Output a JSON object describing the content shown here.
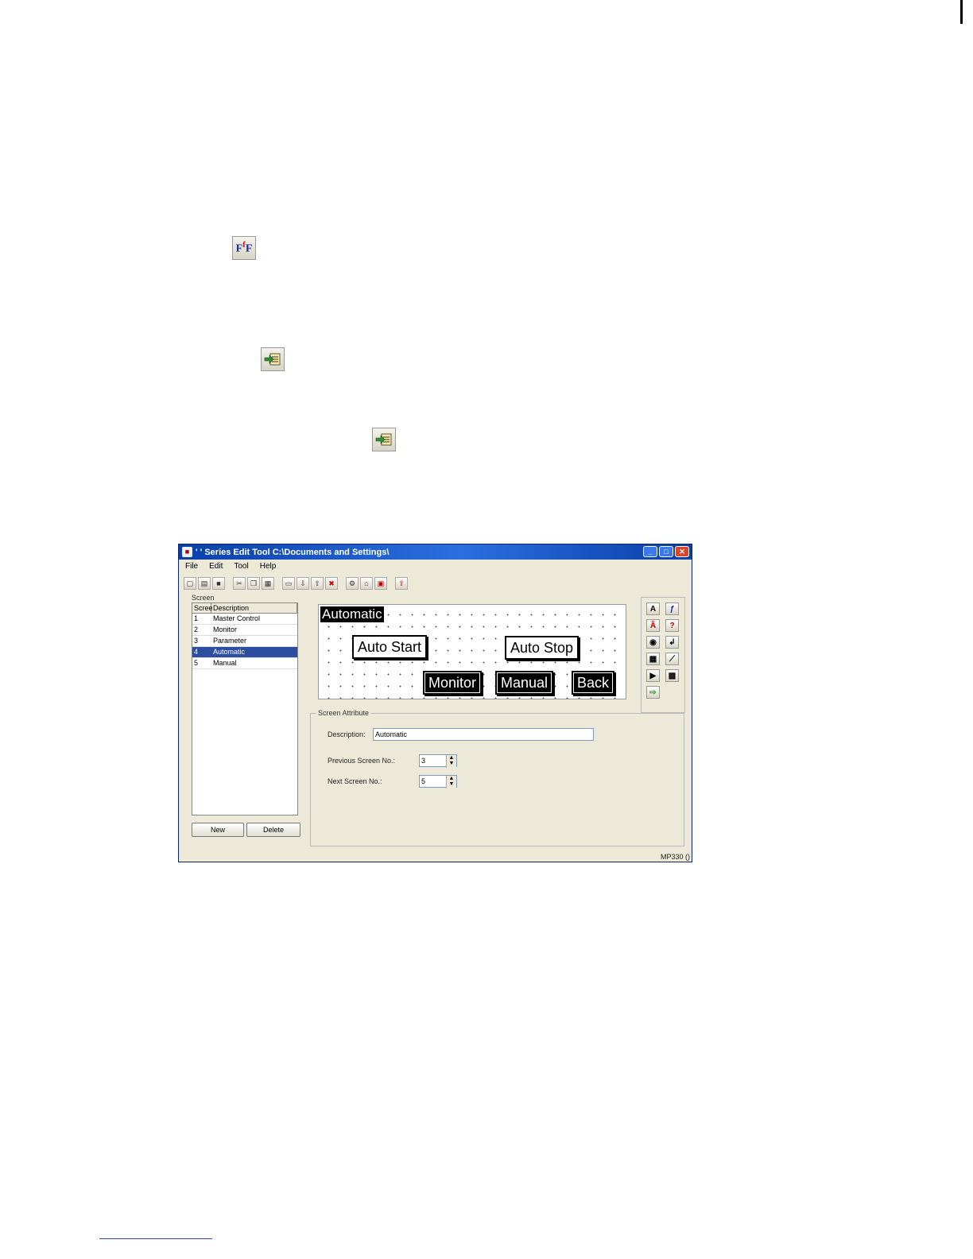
{
  "window": {
    "title": "' ' Series Edit Tool   C:\\Documents and Settings\\",
    "controls": [
      "_",
      "□",
      "✕"
    ]
  },
  "menu": [
    "File",
    "Edit",
    "Tool",
    "Help"
  ],
  "screen_panel": {
    "label": "Screen",
    "columns": [
      "Scree",
      "Description"
    ],
    "rows": [
      {
        "no": "1",
        "desc": "Master Control"
      },
      {
        "no": "2",
        "desc": "Monitor"
      },
      {
        "no": "3",
        "desc": "Parameter"
      },
      {
        "no": "4",
        "desc": "Automatic"
      },
      {
        "no": "5",
        "desc": "Manual"
      }
    ],
    "new_label": "New",
    "delete_label": "Delete"
  },
  "canvas": {
    "title": "Automatic",
    "buttons": {
      "auto_start": "Auto Start",
      "auto_stop": "Auto Stop",
      "monitor": "Monitor",
      "manual": "Manual",
      "back": "Back"
    }
  },
  "attributes": {
    "label": "Screen Attribute",
    "description_label": "Description:",
    "description_value": "Automatic",
    "prev_label": "Previous Screen No.:",
    "prev_value": "3",
    "next_label": "Next Screen No.:",
    "next_value": "5"
  },
  "status": "MP330 ()",
  "icons": {
    "ff": "F",
    "ff_sup": "f",
    "ff_end": "F"
  }
}
